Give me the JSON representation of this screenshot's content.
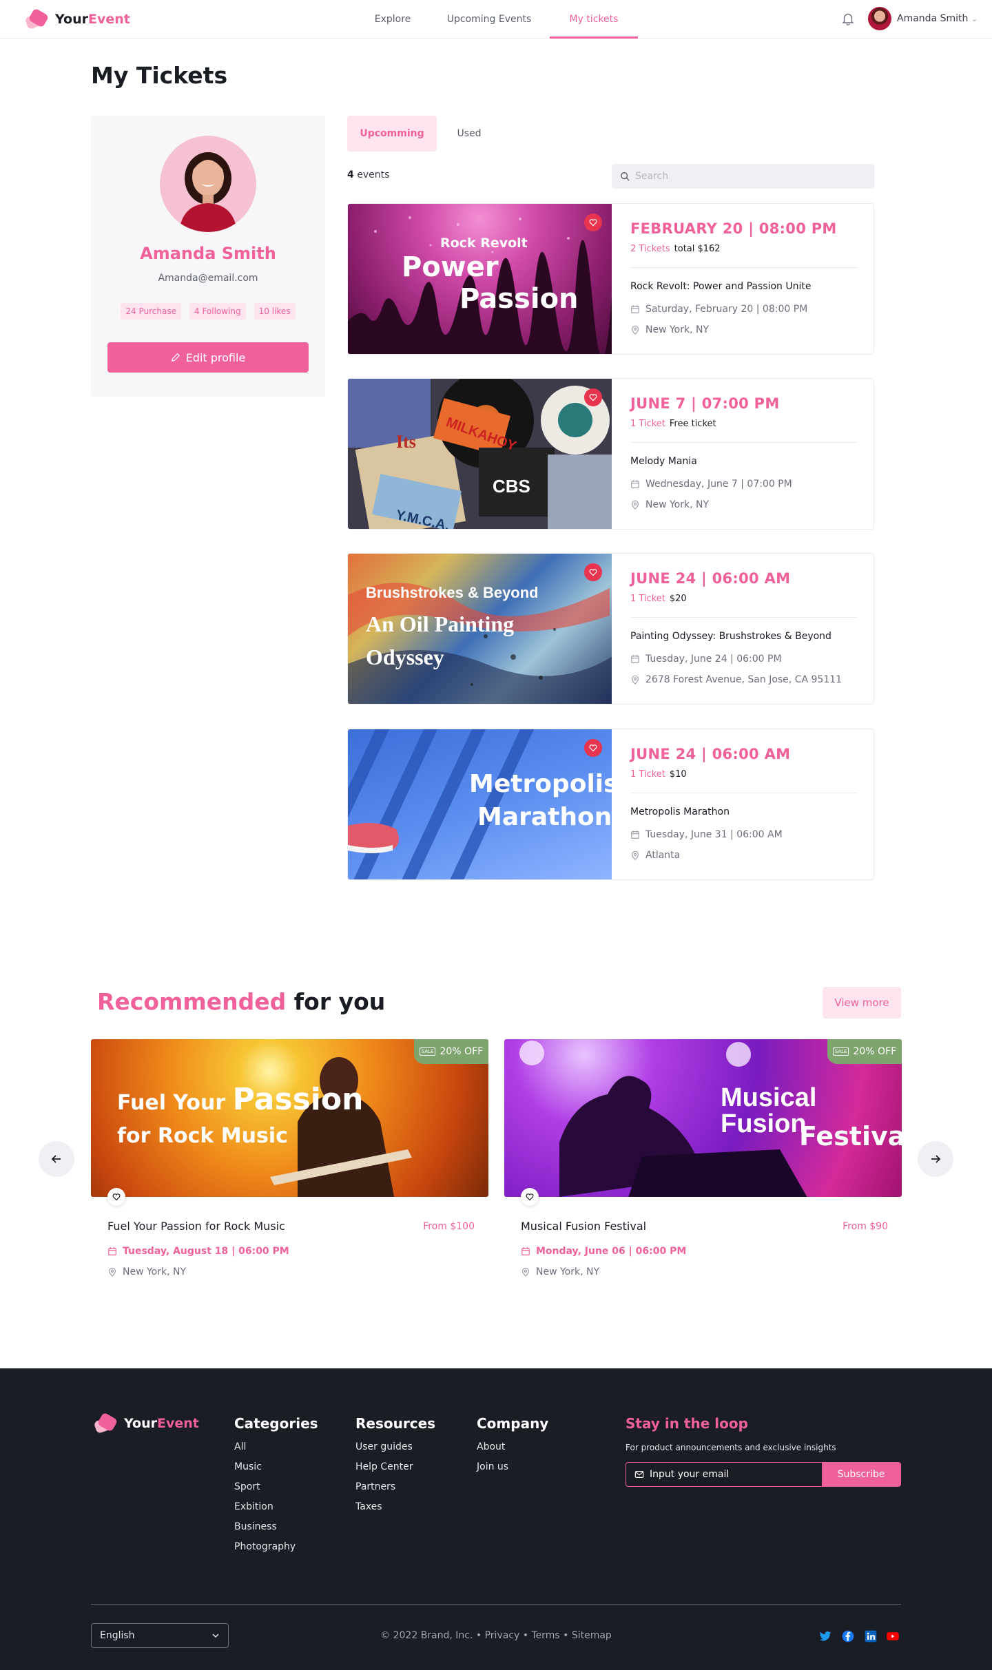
{
  "brand": {
    "name_a": "Your",
    "name_b": "Event"
  },
  "nav": {
    "explore": "Explore",
    "upcoming": "Upcoming Events",
    "tickets": "My tickets"
  },
  "user": {
    "name": "Amanda Smith"
  },
  "page_title": "My Tickets",
  "profile": {
    "name": "Amanda Smith",
    "email": "Amanda@email.com",
    "chips": [
      "24 Purchase",
      "4 Following",
      "10 likes"
    ],
    "edit_label": "Edit profile"
  },
  "tabs": {
    "upcoming": "Upcomming",
    "used": "Used"
  },
  "events_count": {
    "number": "4",
    "label": " events"
  },
  "search": {
    "placeholder": "Search"
  },
  "tickets": [
    {
      "img_line1": "Rock Revolt",
      "img_line2": "Power",
      "img_line3": "Passion",
      "date": "FEBRUARY 20 | 08:00 PM",
      "qty": "2 Tickets",
      "price": "total $162",
      "name": "Rock Revolt: Power and Passion Unite",
      "when": "Saturday, February 20 | 08:00 PM",
      "where": "New York, NY"
    },
    {
      "date": "JUNE 7 | 07:00 PM",
      "qty": "1 Ticket",
      "price": "Free ticket",
      "name": "Melody Mania",
      "when": "Wednesday, June 7 | 07:00 PM",
      "where": "New York, NY"
    },
    {
      "img_line1": "Brushstrokes & Beyond",
      "img_line2": "An Oil Painting",
      "img_line3": "Odyssey",
      "date": "JUNE 24 | 06:00 AM",
      "qty": "1 Ticket",
      "price": "$20",
      "name": "Painting Odyssey: Brushstrokes & Beyond",
      "when": "Tuesday, June 24 | 06:00 PM",
      "where": "2678 Forest Avenue, San Jose, CA 95111"
    },
    {
      "img_line1": "Metropolis",
      "img_line2": "Marathon",
      "date": "JUNE 24 | 06:00 AM",
      "qty": "1 Ticket",
      "price": "$10",
      "name": "Metropolis Marathon",
      "when": "Tuesday, June 31 | 06:00 AM",
      "where": "Atlanta"
    }
  ],
  "recommended": {
    "title_a": "Recommended",
    "title_b": " for you",
    "view_more": "View more"
  },
  "rec_cards": [
    {
      "img_line1": "Fuel Your",
      "img_line1b": "Passion",
      "img_line2": "for Rock Music",
      "off": "20% OFF",
      "name": "Fuel Your Passion for Rock Music",
      "price": "From $100",
      "date": "Tuesday, August 18 | 06:00 PM",
      "where": "New York, NY"
    },
    {
      "img_line1": "Musical Fusion",
      "img_line2": "Festival",
      "off": "20% OFF",
      "name": "Musical Fusion Festival",
      "price": "From $90",
      "date": "Monday, June 06 | 06:00 PM",
      "where": "New York, NY"
    }
  ],
  "sale_tag": "SALE",
  "footer": {
    "categories": {
      "title": "Categories",
      "items": [
        "All",
        "Music",
        "Sport",
        "Exbition",
        "Business",
        "Photography"
      ]
    },
    "resources": {
      "title": "Resources",
      "items": [
        "User guides",
        "Help Center",
        "Partners",
        "Taxes"
      ]
    },
    "company": {
      "title": "Company",
      "items": [
        "About",
        "Join us"
      ]
    },
    "stay": {
      "title": "Stay in the loop",
      "subtitle": "For product announcements and exclusive insights",
      "placeholder": "Input your email",
      "button": "Subscribe"
    },
    "language": "English",
    "copyright": "© 2022 Brand, Inc.  • Privacy  • Terms  • Sitemap"
  },
  "colors": {
    "accent": "#f0609a",
    "dark": "#1b1d24",
    "sale": "#7fa56f",
    "heart": "#e8344e"
  }
}
